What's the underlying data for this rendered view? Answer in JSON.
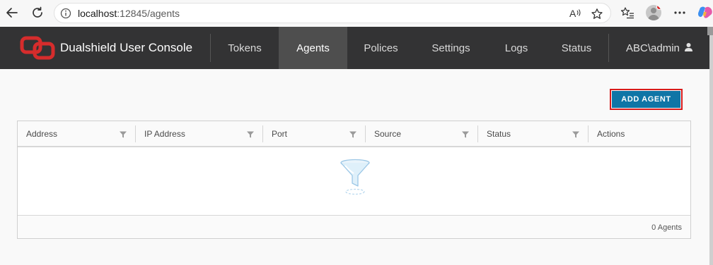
{
  "browser": {
    "url_host": "localhost",
    "url_rest": ":12845/agents",
    "icons": [
      "back-arrow-icon",
      "reload-icon",
      "info-icon",
      "read-aloud-icon",
      "favorite-star-icon",
      "favorites-list-icon",
      "profile-avatar",
      "more-menu-icon",
      "copilot-icon"
    ]
  },
  "header": {
    "brand": "Dualshield User Console",
    "tabs": [
      {
        "label": "Tokens",
        "active": false
      },
      {
        "label": "Agents",
        "active": true
      },
      {
        "label": "Polices",
        "active": false
      },
      {
        "label": "Settings",
        "active": false
      },
      {
        "label": "Logs",
        "active": false
      },
      {
        "label": "Status",
        "active": false
      }
    ],
    "user": "ABC\\admin",
    "logo_color": "#d62c2c",
    "background": "#333334"
  },
  "toolbar": {
    "add_label": "ADD AGENT",
    "add_color": "#0f75a6"
  },
  "grid": {
    "columns": [
      "Address",
      "IP Address",
      "Port",
      "Source",
      "Status",
      "Actions"
    ],
    "rows": [],
    "footer": "0 Agents"
  }
}
